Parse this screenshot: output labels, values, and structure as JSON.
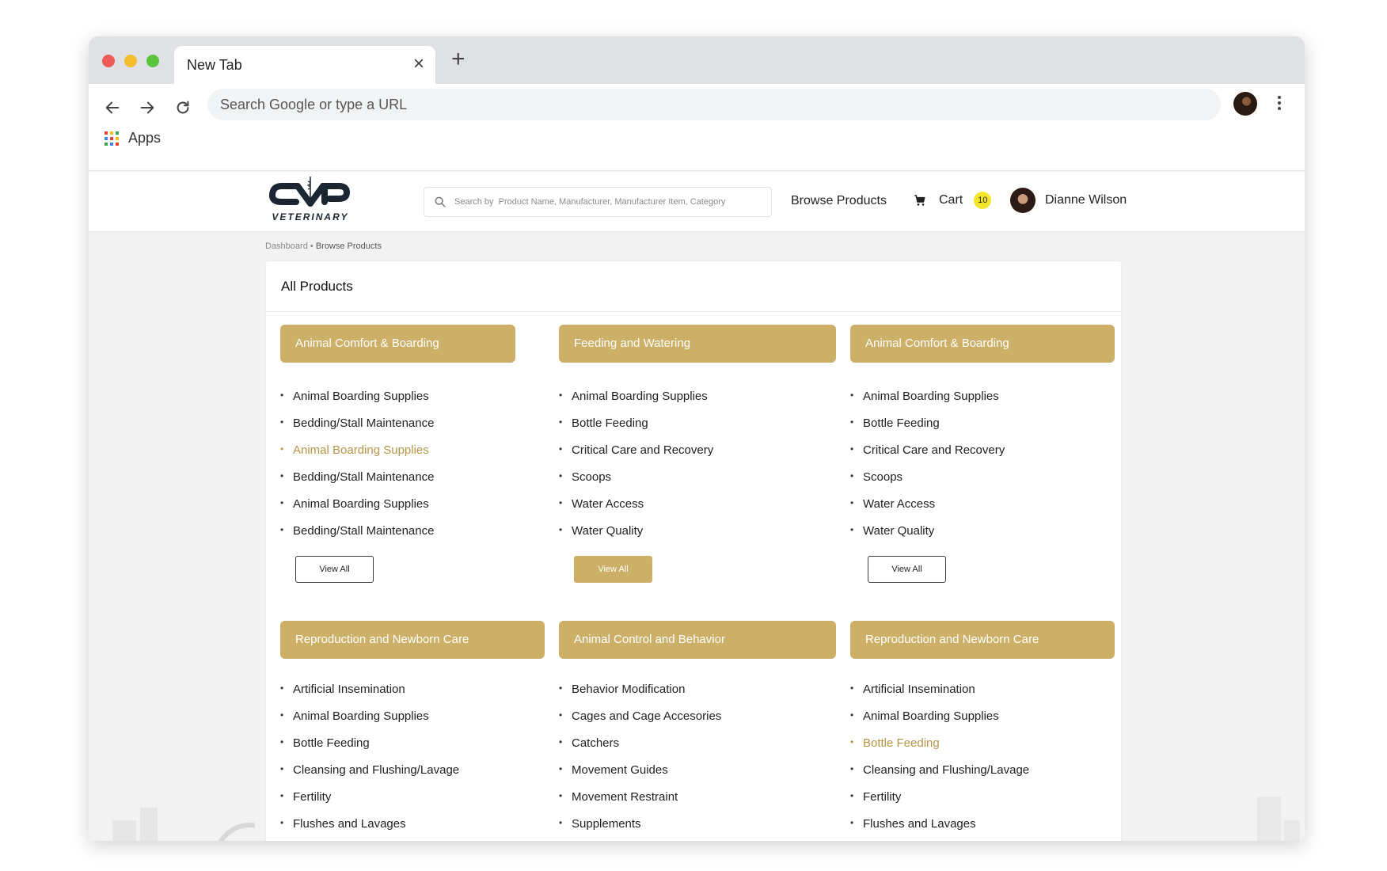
{
  "browser": {
    "tab_title": "New Tab",
    "omnibox_placeholder": "Search Google or type a URL",
    "bookmarks": {
      "apps_label": "Apps"
    }
  },
  "header": {
    "logo_text": "VETERINARY",
    "search_placeholder": "Search by  Product Name, Manufacturer, Manufacturer Item, Category",
    "nav_browse": "Browse Products",
    "cart_label": "Cart",
    "cart_count": "10",
    "user_name": "Dianne Wilson"
  },
  "breadcrumb": {
    "home": "Dashboard",
    "separator": "•",
    "current": "Browse Products"
  },
  "panel_title": "All Products",
  "categories": [
    {
      "title": "Animal Comfort & Boarding",
      "items": [
        "Animal  Boarding Supplies",
        "Bedding/Stall Maintenance",
        "Animal Boarding Supplies",
        "Bedding/Stall Maintenance",
        "Animal Boarding Supplies",
        "Bedding/Stall Maintenance"
      ],
      "view_all": "View All"
    },
    {
      "title": "Feeding  and Watering",
      "items": [
        "Animal Boarding Supplies",
        "Bottle Feeding",
        "Critical Care and Recovery",
        "Scoops",
        "Water Access",
        "Water Quality"
      ],
      "view_all": "View All"
    },
    {
      "title": "Animal Comfort & Boarding",
      "items": [
        "Animal Boarding Supplies",
        "Bottle Feeding",
        "Critical Care and Recovery",
        "Scoops",
        "Water Access",
        "Water Quality"
      ],
      "view_all": "View All"
    },
    {
      "title": "Reproduction and Newborn Care",
      "items": [
        "Artificial Insemination",
        "Animal Boarding Supplies",
        "Bottle Feeding",
        "Cleansing  and Flushing/Lavage",
        "Fertility",
        "Flushes and Lavages"
      ]
    },
    {
      "title": "Animal Control and Behavior",
      "items": [
        "Behavior Modification",
        "Cages and Cage Accesories",
        "Catchers",
        "Movement Guides",
        "Movement Restraint",
        "Supplements"
      ]
    },
    {
      "title": "Reproduction and Newborn Care",
      "items": [
        "Artificial Insemination",
        "Animal Boarding Supplies",
        "Bottle Feeding",
        "Cleansing  and Flushing/Lavage",
        "Fertility",
        "Flushes and Lavages"
      ]
    }
  ],
  "colors": {
    "accent": "#cdb068",
    "accent_text": "#b89447",
    "cart_badge": "#f3e62a"
  }
}
